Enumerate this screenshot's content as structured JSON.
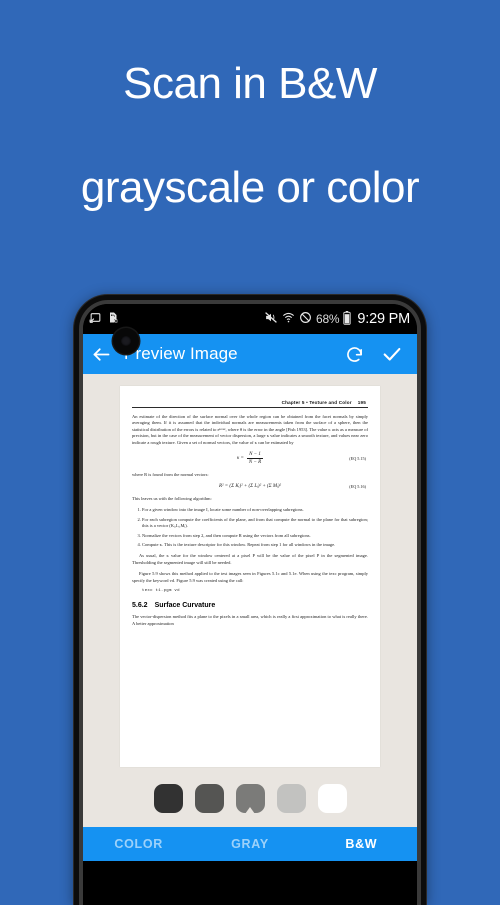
{
  "promo": {
    "line1": "Scan in B&W",
    "line2": "grayscale or color",
    "background_color": "#3068b8",
    "text_color": "#ffffff"
  },
  "phone": {
    "statusbar": {
      "icons_left": [
        "screenshot-icon",
        "sdcard-removed-icon"
      ],
      "icons_right": [
        "vibrate-muted-icon",
        "wifi-icon",
        "do-not-disturb-icon"
      ],
      "battery_percent": "68%",
      "battery_icon": "battery-icon",
      "clock": "9:29 PM",
      "background_color": "#000000"
    },
    "appbar": {
      "back_icon": "back-arrow-icon",
      "title": "Preview Image",
      "rotate_icon": "rotate-clockwise-icon",
      "confirm_icon": "checkmark-icon",
      "accent_color": "#1592f2"
    },
    "document": {
      "header_chapter": "Chapter 5  •  Texture and Color",
      "header_page": "195",
      "paragraph_1": "An estimate of the direction of the surface normal over the whole region can be obtained from the facet normals by simply averaging them. If it is assumed that the individual normals are measurements taken from the surface of a sphere, then the statistical distribution of the errors is related to eᵏᶜᵒˢᵉ, where θ is the error in the angle [Fish 1953]. The value κ acts as a measure of precision, but in the case of the measurement of vector dispersion, a large κ value indicates a smooth texture, and values near zero indicate a rough texture. Given a set of normal vectors, the value of κ can be estimated by",
      "equation_1": {
        "lhs": "κ =",
        "numerator": "N − 1",
        "denominator": "N − R",
        "tag": "(EQ 5.15)"
      },
      "paragraph_2": "where R is found from the normal vectors:",
      "equation_2": {
        "expr": "R² = (Σ Kᵢ)² + (Σ Lᵢ)² + (Σ Mᵢ)²",
        "tag": "(EQ 5.16)"
      },
      "paragraph_3": "This leaves us with the following algorithm:",
      "steps": [
        "For a given window into the image I, locate some number of non-overlapping subregions.",
        "For each subregion compute the coefficients of the plane, and from that compute the normal to the plane for that subregion; this is a vector (Kᵢ,Lᵢ,Mᵢ).",
        "Normalize the vectors from step 2, and then compute R using the vectors from all subregions.",
        "Compute κ. This is the texture descriptor for this window. Repeat from step 1 for all windows in the image."
      ],
      "paragraph_4": "As usual, the κ value for the window centered at a pixel P will be the value of the pixel P in the segmented image. Thresholding the segmented image will still be needed.",
      "paragraph_5": "Figure 5.9 shows this method applied to the test images seen in Figures 5.1c and 5.1e. When using the texc program, simply specify the keyword vd. Figure 5.9 was created using the call:",
      "code_line": "texc t1.pgm vd",
      "section_number": "5.6.2",
      "section_title": "Surface Curvature",
      "paragraph_6": "The vector-dispersion method fits a plane to the pixels in a small area, which is really a first approximation to what is really there. A better approximation",
      "paper_color": "#ffffff",
      "viewer_background": "#e9e5e0"
    },
    "swatches": [
      {
        "name": "swatch-darkest",
        "color": "#323232",
        "selected": false
      },
      {
        "name": "swatch-dark",
        "color": "#555553",
        "selected": false
      },
      {
        "name": "swatch-medium",
        "color": "#7b7b79",
        "selected": true
      },
      {
        "name": "swatch-light",
        "color": "#c2c2c0",
        "selected": false
      },
      {
        "name": "swatch-white",
        "color": "#ffffff",
        "selected": false
      }
    ],
    "tabs": [
      {
        "label": "COLOR",
        "active": false
      },
      {
        "label": "GRAY",
        "active": false
      },
      {
        "label": "B&W",
        "active": true
      }
    ]
  }
}
